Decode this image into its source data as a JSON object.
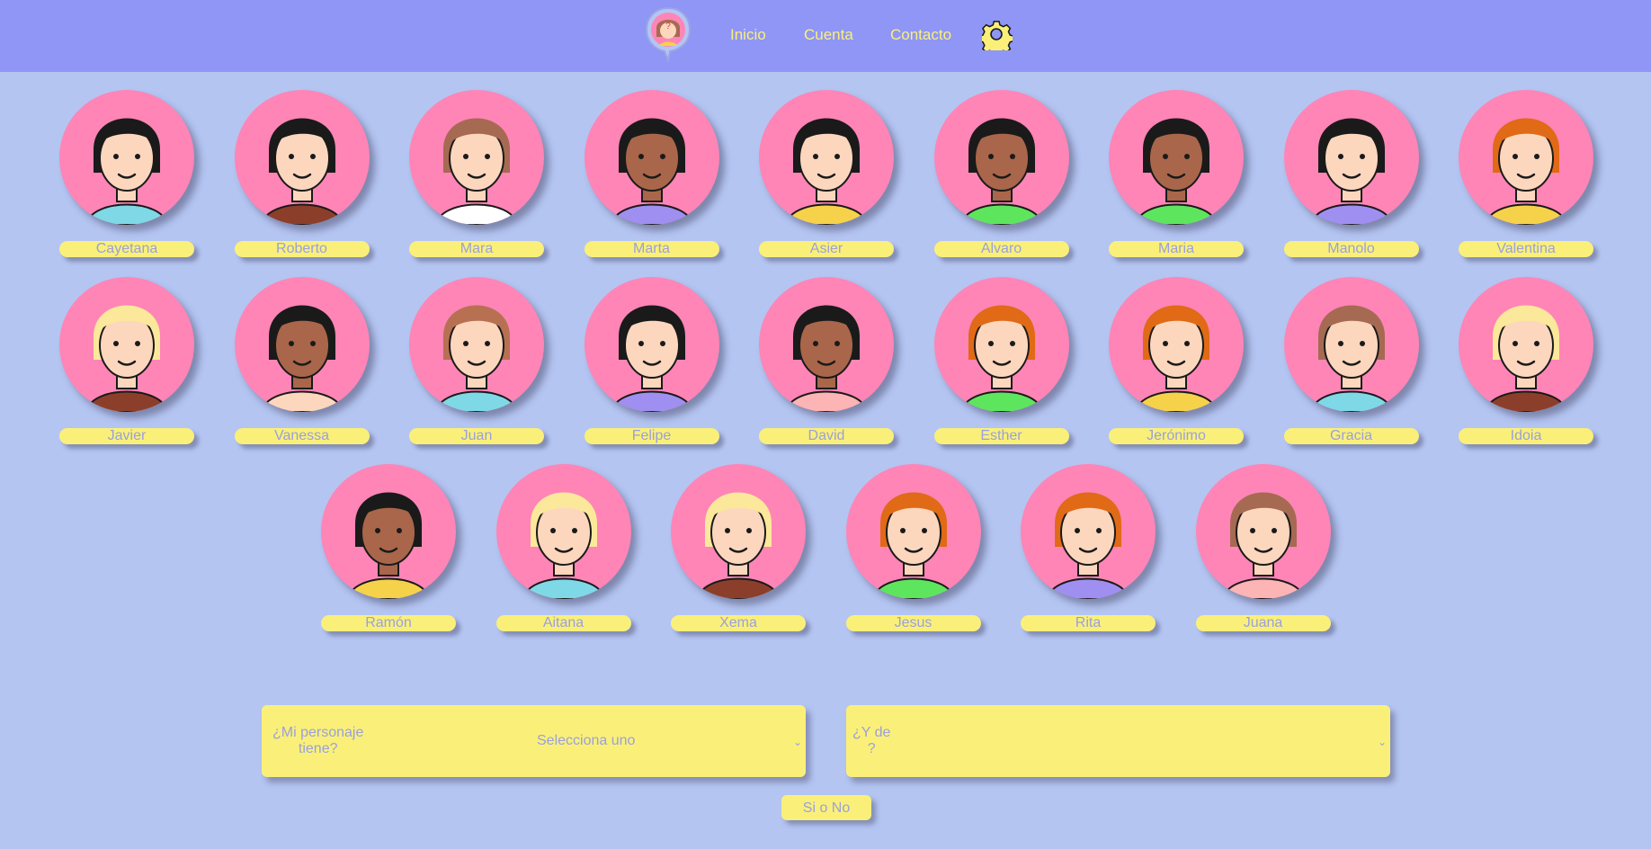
{
  "nav": {
    "links": [
      "Inicio",
      "Cuenta",
      "Contacto"
    ],
    "logo_icon": "detective-avatar-logo",
    "settings_icon": "gear-icon"
  },
  "characters": [
    {
      "name": "Cayetana",
      "skin": "#fcd7bd",
      "hair": "#1a1a1a",
      "shirt": "#7fd8e6"
    },
    {
      "name": "Roberto",
      "skin": "#fcd7bd",
      "hair": "#1a1a1a",
      "shirt": "#8b3f2a"
    },
    {
      "name": "Mara",
      "skin": "#fcd7bd",
      "hair": "#a66a52",
      "shirt": "#ffffff"
    },
    {
      "name": "Marta",
      "skin": "#a9664a",
      "hair": "#1a1a1a",
      "shirt": "#9f8ff0"
    },
    {
      "name": "Asier",
      "skin": "#fcd7bd",
      "hair": "#1a1a1a",
      "shirt": "#f5d24a"
    },
    {
      "name": "Alvaro",
      "skin": "#a9664a",
      "hair": "#1a1a1a",
      "shirt": "#5ee55e"
    },
    {
      "name": "Maria",
      "skin": "#a9664a",
      "hair": "#1a1a1a",
      "shirt": "#5ee55e"
    },
    {
      "name": "Manolo",
      "skin": "#fcd7bd",
      "hair": "#1a1a1a",
      "shirt": "#9f8ff0"
    },
    {
      "name": "Valentina",
      "skin": "#fcd7bd",
      "hair": "#e06a16",
      "shirt": "#f5d24a"
    },
    {
      "name": "Javier",
      "skin": "#fcd7bd",
      "hair": "#fbe89a",
      "shirt": "#8b3f2a"
    },
    {
      "name": "Vanessa",
      "skin": "#a9664a",
      "hair": "#1a1a1a",
      "shirt": "#fcd7bd"
    },
    {
      "name": "Juan",
      "skin": "#fcd7bd",
      "hair": "#b87052",
      "shirt": "#7fd8e6"
    },
    {
      "name": "Felipe",
      "skin": "#fcd7bd",
      "hair": "#1a1a1a",
      "shirt": "#9f8ff0"
    },
    {
      "name": "David",
      "skin": "#a9664a",
      "hair": "#1a1a1a",
      "shirt": "#fcb4b4"
    },
    {
      "name": "Esther",
      "skin": "#fcd7bd",
      "hair": "#e06a16",
      "shirt": "#5ee55e"
    },
    {
      "name": "Jerónimo",
      "skin": "#fcd7bd",
      "hair": "#e06a16",
      "shirt": "#f5d24a"
    },
    {
      "name": "Gracia",
      "skin": "#fcd7bd",
      "hair": "#a66a52",
      "shirt": "#7fd8e6"
    },
    {
      "name": "Idoia",
      "skin": "#fcd7bd",
      "hair": "#fbe89a",
      "shirt": "#8b3f2a"
    },
    {
      "name": "Ramón",
      "skin": "#a9664a",
      "hair": "#1a1a1a",
      "shirt": "#f5d24a"
    },
    {
      "name": "Aitana",
      "skin": "#fcd7bd",
      "hair": "#fbe89a",
      "shirt": "#7fd8e6"
    },
    {
      "name": "Xema",
      "skin": "#fcd7bd",
      "hair": "#fbe89a",
      "shirt": "#8b3f2a"
    },
    {
      "name": "Jesus",
      "skin": "#fcd7bd",
      "hair": "#e06a16",
      "shirt": "#5ee55e"
    },
    {
      "name": "Rita",
      "skin": "#fcd7bd",
      "hair": "#e06a16",
      "shirt": "#9f8ff0"
    },
    {
      "name": "Juana",
      "skin": "#fcd7bd",
      "hair": "#a66a52",
      "shirt": "#fcb4b4"
    }
  ],
  "question": {
    "label1_line1": "¿Mi personaje",
    "label1_line2": "tiene?",
    "select1_value": "Selecciona uno",
    "label2_line1": "¿Y de",
    "label2_line2": "?",
    "select2_value": "",
    "button_label": "Si o No"
  },
  "colors": {
    "background": "#b4c5f2",
    "navbar": "#8f96f5",
    "accent_yellow": "#faf079",
    "avatar_pink": "#fe85b6",
    "text_muted": "#9aa0dd"
  }
}
